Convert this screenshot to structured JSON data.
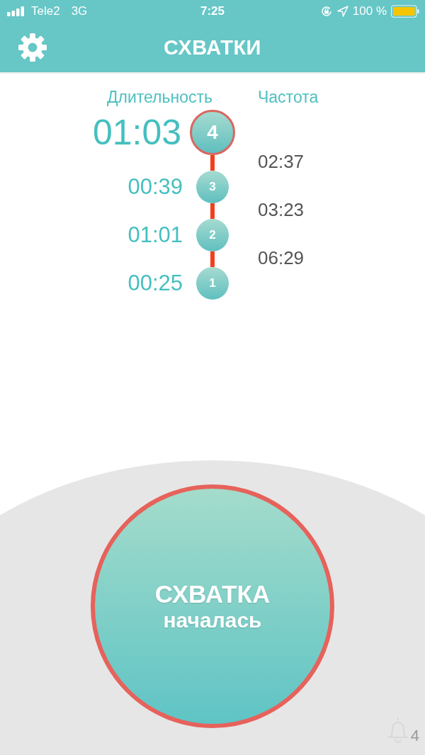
{
  "status_bar": {
    "carrier": "Tele2",
    "network": "3G",
    "time": "7:25",
    "battery": "100 %"
  },
  "header": {
    "title": "СХВАТКИ"
  },
  "timeline": {
    "duration_heading": "Длительность",
    "frequency_heading": "Частота",
    "contractions": [
      {
        "number": "4",
        "duration": "01:03",
        "selected": true,
        "interval": "02:37"
      },
      {
        "number": "3",
        "duration": "00:39",
        "selected": false,
        "interval": "03:23"
      },
      {
        "number": "2",
        "duration": "01:01",
        "selected": false,
        "interval": "06:29"
      },
      {
        "number": "1",
        "duration": "00:25",
        "selected": false
      }
    ]
  },
  "start_button": {
    "line_1": "СХВАТКА",
    "line_2": "началась"
  },
  "notifications": {
    "count": "4"
  }
}
